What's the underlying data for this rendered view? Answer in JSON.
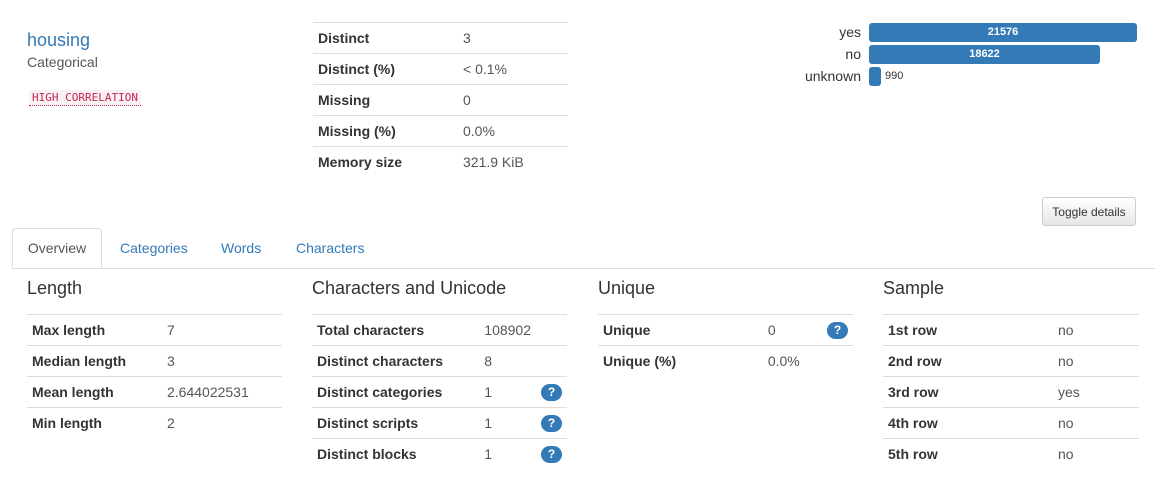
{
  "variable": {
    "name": "housing",
    "type": "Categorical",
    "alert": "HIGH CORRELATION"
  },
  "overview_stats": [
    {
      "label": "Distinct",
      "value": "3"
    },
    {
      "label": "Distinct (%)",
      "value": "< 0.1%"
    },
    {
      "label": "Missing",
      "value": "0"
    },
    {
      "label": "Missing (%)",
      "value": "0.0%"
    },
    {
      "label": "Memory size",
      "value": "321.9 KiB"
    }
  ],
  "chart_data": {
    "type": "bar",
    "orientation": "horizontal",
    "categories": [
      "yes",
      "no",
      "unknown"
    ],
    "values": [
      21576,
      18622,
      990
    ],
    "color": "#337ab7"
  },
  "toggle_button": "Toggle details",
  "tabs": [
    {
      "label": "Overview",
      "active": true
    },
    {
      "label": "Categories",
      "active": false
    },
    {
      "label": "Words",
      "active": false
    },
    {
      "label": "Characters",
      "active": false
    }
  ],
  "sections": {
    "length": {
      "title": "Length",
      "rows": [
        {
          "label": "Max length",
          "value": "7"
        },
        {
          "label": "Median length",
          "value": "3"
        },
        {
          "label": "Mean length",
          "value": "2.644022531"
        },
        {
          "label": "Min length",
          "value": "2"
        }
      ]
    },
    "characters": {
      "title": "Characters and Unicode",
      "rows": [
        {
          "label": "Total characters",
          "value": "108902",
          "help": false
        },
        {
          "label": "Distinct characters",
          "value": "8",
          "help": false
        },
        {
          "label": "Distinct categories",
          "value": "1",
          "help": true
        },
        {
          "label": "Distinct scripts",
          "value": "1",
          "help": true
        },
        {
          "label": "Distinct blocks",
          "value": "1",
          "help": true
        }
      ]
    },
    "unique": {
      "title": "Unique",
      "rows": [
        {
          "label": "Unique",
          "value": "0",
          "help": true
        },
        {
          "label": "Unique (%)",
          "value": "0.0%",
          "help": false
        }
      ]
    },
    "sample": {
      "title": "Sample",
      "rows": [
        {
          "label": "1st row",
          "value": "no"
        },
        {
          "label": "2nd row",
          "value": "no"
        },
        {
          "label": "3rd row",
          "value": "yes"
        },
        {
          "label": "4th row",
          "value": "no"
        },
        {
          "label": "5th row",
          "value": "no"
        }
      ]
    }
  },
  "help_icon": "?"
}
